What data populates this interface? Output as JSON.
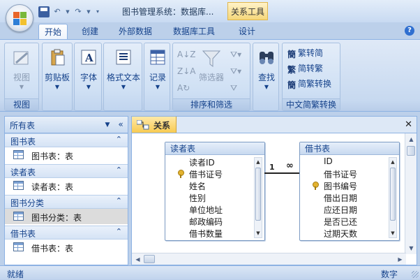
{
  "window": {
    "title": "图书管理系统：数据库...",
    "context_tab_title": "关系工具"
  },
  "ribbon_tabs": [
    {
      "label": "开始",
      "active": true
    },
    {
      "label": "创建"
    },
    {
      "label": "外部数据"
    },
    {
      "label": "数据库工具"
    },
    {
      "label": "设计"
    }
  ],
  "ribbon": {
    "view": {
      "label": "视图",
      "group": "视图"
    },
    "clipboard": {
      "label": "剪贴板"
    },
    "font": {
      "label": "字体"
    },
    "rich_text": {
      "label": "格式文本"
    },
    "records": {
      "label": "记录"
    },
    "sort_filter": {
      "filter_label": "筛选器",
      "group": "排序和筛选"
    },
    "find": {
      "label": "查找"
    },
    "chinese_conv": {
      "to_traditional": "繁转简",
      "to_simplified": "简转繁",
      "convert": "简繁转换",
      "group": "中文简繁转换"
    }
  },
  "nav_pane": {
    "header": "所有表",
    "groups": [
      {
        "title": "图书表",
        "item": "图书表：表"
      },
      {
        "title": "读者表",
        "item": "读者表：表"
      },
      {
        "title": "图书分类",
        "item": "图书分类：表",
        "selected": true
      },
      {
        "title": "借书表",
        "item": "借书表：表"
      }
    ]
  },
  "document": {
    "tab_label": "关系",
    "tables": [
      {
        "name": "读者表",
        "fields": [
          "读者ID",
          "借书证号",
          "姓名",
          "性别",
          "单位地址",
          "邮政编码",
          "借书数量"
        ],
        "key_field_index": 1
      },
      {
        "name": "借书表",
        "fields": [
          "ID",
          "借书证号",
          "图书编号",
          "借出日期",
          "应还日期",
          "是否已还",
          "过期天数"
        ],
        "key_field_index": 2
      }
    ],
    "relationship": {
      "one": "1",
      "many": "∞"
    }
  },
  "status": {
    "left": "就绪",
    "right": "数字"
  },
  "colors": {
    "accent": "#15428b",
    "context_tab": "#f5d77a",
    "doc_tab": "#f7c94e"
  }
}
